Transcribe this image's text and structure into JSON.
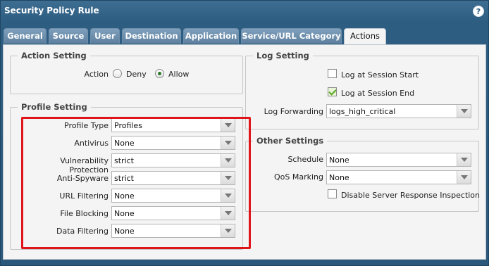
{
  "window": {
    "title": "Security Policy Rule",
    "help_glyph": "?"
  },
  "tabs": [
    {
      "label": "General"
    },
    {
      "label": "Source"
    },
    {
      "label": "User"
    },
    {
      "label": "Destination"
    },
    {
      "label": "Application"
    },
    {
      "label": "Service/URL Category"
    },
    {
      "label": "Actions",
      "active": true
    }
  ],
  "action_setting": {
    "title": "Action Setting",
    "label": "Action",
    "options": [
      {
        "label": "Deny",
        "selected": false
      },
      {
        "label": "Allow",
        "selected": true
      }
    ]
  },
  "profile_setting": {
    "title": "Profile Setting",
    "rows": [
      {
        "label": "Profile Type",
        "value": "Profiles"
      },
      {
        "label": "Antivirus",
        "value": "None"
      },
      {
        "label": "Vulnerability Protection",
        "value": "strict"
      },
      {
        "label": "Anti-Spyware",
        "value": "strict"
      },
      {
        "label": "URL Filtering",
        "value": "None"
      },
      {
        "label": "File Blocking",
        "value": "None"
      },
      {
        "label": "Data Filtering",
        "value": "None"
      }
    ]
  },
  "log_setting": {
    "title": "Log Setting",
    "log_start": {
      "label": "Log at Session Start",
      "checked": false
    },
    "log_end": {
      "label": "Log at Session End",
      "checked": true
    },
    "forwarding": {
      "label": "Log Forwarding",
      "value": "logs_high_critical"
    }
  },
  "other_settings": {
    "title": "Other Settings",
    "schedule": {
      "label": "Schedule",
      "value": "None"
    },
    "qos": {
      "label": "QoS Marking",
      "value": "None"
    },
    "disable_inspection": {
      "label": "Disable Server Response Inspection",
      "checked": false
    }
  },
  "colors": {
    "highlight_box": "#e0151b",
    "window_bg": "#2e5d82",
    "panel_bg": "#f4f4f4"
  }
}
